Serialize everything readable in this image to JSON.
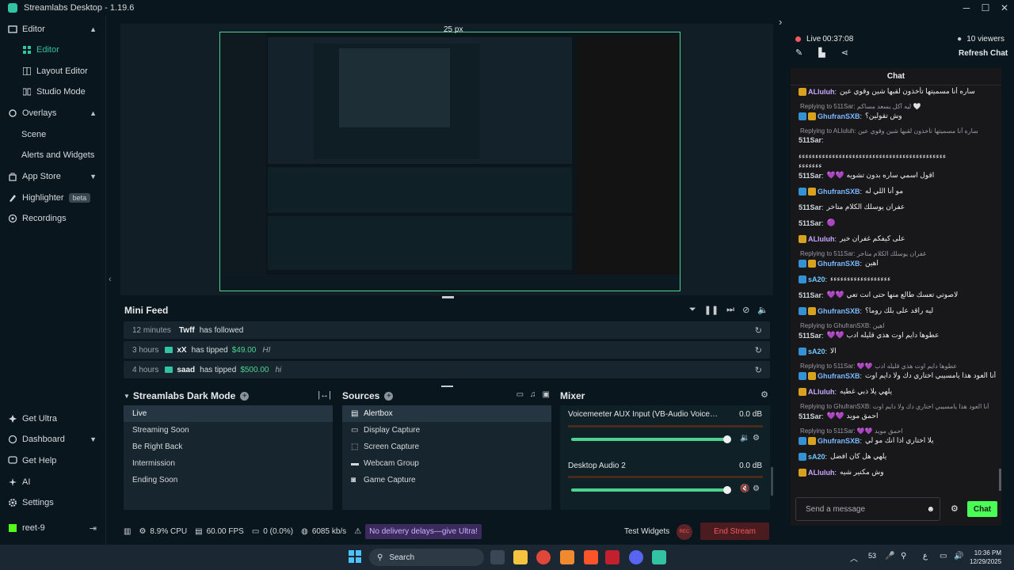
{
  "window": {
    "title": "Streamlabs Desktop - 1.19.6"
  },
  "sidebar": {
    "items": [
      {
        "label": "Editor",
        "icon": "editor-icon"
      },
      {
        "label": "Editor",
        "icon": "editor-grid-icon"
      },
      {
        "label": "Layout Editor",
        "icon": "layout-icon"
      },
      {
        "label": "Studio Mode",
        "icon": "studio-icon"
      },
      {
        "label": "Overlays",
        "icon": "overlays-icon"
      },
      {
        "label": "Scene"
      },
      {
        "label": "Alerts and Widgets"
      },
      {
        "label": "App Store",
        "icon": "app-store-icon"
      },
      {
        "label": "Highlighter",
        "icon": "highlighter-icon",
        "badge": "beta"
      },
      {
        "label": "Recordings",
        "icon": "recordings-icon"
      }
    ],
    "bottom": [
      {
        "label": "Get Ultra"
      },
      {
        "label": "Dashboard"
      },
      {
        "label": "Get Help"
      },
      {
        "label": "AI"
      },
      {
        "label": "Settings"
      },
      {
        "label": "reet-9"
      }
    ]
  },
  "preview": {
    "label": "25 px"
  },
  "minifeed": {
    "title": "Mini Feed",
    "events": [
      {
        "time": "12 minutes",
        "user": "Twff",
        "action": "has followed",
        "amount": "",
        "message": ""
      },
      {
        "time": "3 hours",
        "user": "xX",
        "action": "has tipped",
        "amount": "$49.00",
        "message": "HI"
      },
      {
        "time": "4 hours",
        "user": "saad",
        "action": "has tipped",
        "amount": "$500.00",
        "message": "hi"
      }
    ]
  },
  "scenes": {
    "title": "Streamlabs Dark Mode",
    "items": [
      "Live",
      "Streaming Soon",
      "Be Right Back",
      "Intermission",
      "Ending Soon"
    ]
  },
  "sources": {
    "title": "Sources",
    "items": [
      "Alertbox",
      "Display Capture",
      "Screen Capture",
      "Webcam Group",
      "Game Capture"
    ]
  },
  "mixer": {
    "title": "Mixer",
    "channels": [
      {
        "name": "Voicemeeter AUX Input (VB-Audio Voicemeeter...",
        "db": "0.0 dB",
        "level": 1.0
      },
      {
        "name": "Desktop Audio 2",
        "db": "0.0 dB",
        "level": 1.0
      }
    ]
  },
  "status": {
    "cpu": "8.9% CPU",
    "fps": "60.00 FPS",
    "dropped": "0 (0.0%)",
    "bitrate": "6085 kb/s",
    "promo": "No delivery delays—give Ultra!",
    "test_widgets": "Test Widgets",
    "rec": "REC",
    "end_stream": "End Stream"
  },
  "chat": {
    "live": "Live",
    "timer": "00:37:08",
    "viewers": "10 viewers",
    "refresh": "Refresh Chat",
    "header": "Chat",
    "messages": [
      {
        "type": "msg",
        "badges": [
          "crown"
        ],
        "user": "ALluluh",
        "cls": "u1",
        "text": "ساره أنا مسميتها تأخذون لقبها شين وقوي عين"
      },
      {
        "type": "reply",
        "text": "Replying to 511Sar: ليه أكل يسعد مساكم 🤍"
      },
      {
        "type": "msg",
        "badges": [
          "arrow",
          "crown"
        ],
        "user": "GhufranSXB",
        "cls": "u2",
        "text": "وش تقولين؟"
      },
      {
        "type": "reply",
        "text": "Replying to ALluluh: ساره أنا مسميتها تأخذون لقبها شين وقوي عين"
      },
      {
        "type": "msg",
        "badges": [],
        "user": "511Sar",
        "cls": "u3",
        "text": ""
      },
      {
        "type": "cont",
        "text": "ءءءءءءءءءءءءءءءءءءءءءءءءءءءءءءءءءءءءءءءءءءءء"
      },
      {
        "type": "cont",
        "text": "ءءءءءءء"
      },
      {
        "type": "msg",
        "badges": [],
        "user": "511Sar",
        "cls": "u3",
        "text": "💜💜 اقول اسمي ساره بدون تشويه"
      },
      {
        "type": "msg",
        "badges": [
          "arrow",
          "crown"
        ],
        "user": "GhufranSXB",
        "cls": "u2",
        "text": "مو أنا اللي له"
      },
      {
        "type": "msg",
        "badges": [],
        "user": "511Sar",
        "cls": "u3",
        "text": "عفران يوسلك الكلام متاخر"
      },
      {
        "type": "msg",
        "badges": [],
        "user": "511Sar",
        "cls": "u3",
        "text": "🟣"
      },
      {
        "type": "msg",
        "badges": [
          "crown"
        ],
        "user": "ALluluh",
        "cls": "u1",
        "text": "على كيفكم غفران خير"
      },
      {
        "type": "reply",
        "text": "Replying to 511Sar: غفران يوسلك الكلام متاخر"
      },
      {
        "type": "msg",
        "badges": [
          "arrow",
          "crown"
        ],
        "user": "GhufranSXB",
        "cls": "u2",
        "text": "اهين"
      },
      {
        "type": "msg",
        "badges": [
          "arrow"
        ],
        "user": "sA20",
        "cls": "u4",
        "text": "ءءءءءءءءءءءءءءءءءء"
      },
      {
        "type": "msg",
        "badges": [],
        "user": "511Sar",
        "cls": "u3",
        "text": "💜💜 لاصوتي تعسك طالع منها حتى انت تعي"
      },
      {
        "type": "msg",
        "badges": [
          "arrow",
          "crown"
        ],
        "user": "GhufranSXB",
        "cls": "u2",
        "text": "ليه راقد على بلك روما؟"
      },
      {
        "type": "reply",
        "text": "Replying to GhufranSXB: اهين"
      },
      {
        "type": "msg",
        "badges": [],
        "user": "511Sar",
        "cls": "u3",
        "text": "💜💜 عطوها دايم اوت هذي قليله ادب"
      },
      {
        "type": "msg",
        "badges": [
          "arrow"
        ],
        "user": "sA20",
        "cls": "u4",
        "text": "الا"
      },
      {
        "type": "reply",
        "text": "Replying to 511Sar: 💜💜 عطوها دايم اوت هذي قليله ادب"
      },
      {
        "type": "msg",
        "badges": [
          "arrow",
          "crown"
        ],
        "user": "GhufranSXB",
        "cls": "u2",
        "text": "أنا العود هذا يامسيبي اختاري دك ولا دايم اوت"
      },
      {
        "type": "msg",
        "badges": [
          "crown"
        ],
        "user": "ALluluh",
        "cls": "u1",
        "text": "يلهي يلا ذبي غطيه"
      },
      {
        "type": "reply",
        "text": "Replying to GhufranSXB: أنا العود هذا يامسيبي اختاري دك ولا دايم اوت"
      },
      {
        "type": "msg",
        "badges": [],
        "user": "511Sar",
        "cls": "u3",
        "text": "💜💜 احمق مويد"
      },
      {
        "type": "reply",
        "text": "Replying to 511Sar: 💜💜 احمق مويد"
      },
      {
        "type": "msg",
        "badges": [
          "arrow",
          "crown"
        ],
        "user": "GhufranSXB",
        "cls": "u2",
        "text": "يلا اختاري اذا انك مو لي"
      },
      {
        "type": "msg",
        "badges": [
          "arrow"
        ],
        "user": "sA20",
        "cls": "u4",
        "text": "يلهي هل كان افضل"
      },
      {
        "type": "msg",
        "badges": [
          "crown"
        ],
        "user": "ALluluh",
        "cls": "u1",
        "text": "وش مكنير شيه"
      }
    ],
    "input_placeholder": "Send a message",
    "send": "Chat"
  },
  "taskbar": {
    "search": "Search",
    "tray_num": "53",
    "lang": "ع",
    "time": "10:36 PM",
    "date": "12/29/2025"
  },
  "colors": {
    "accent": "#31c3a2",
    "green": "#4cd38f",
    "end_stream": "#f35a60",
    "chat_button": "#49ff56"
  }
}
